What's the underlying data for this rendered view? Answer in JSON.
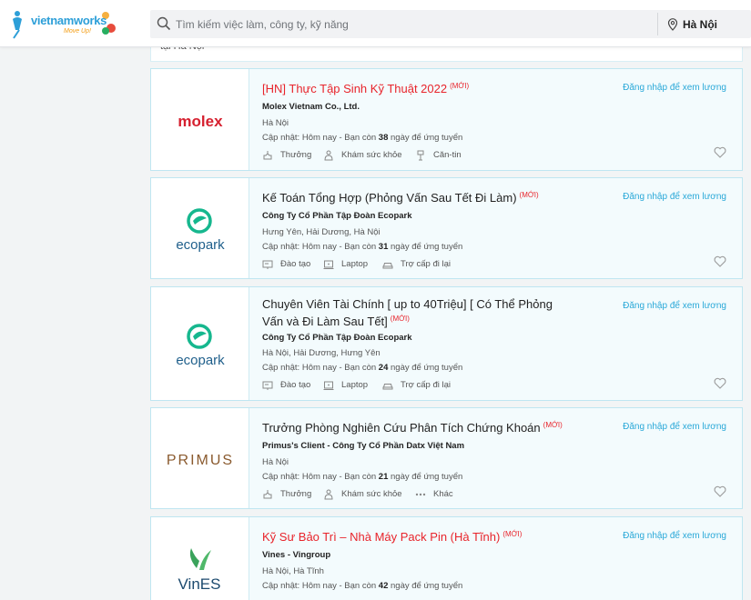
{
  "header": {
    "logo_text": "vietnamworks",
    "logo_tagline": "Move Up!",
    "search": {
      "placeholder": "Tìm kiếm việc làm, công ty, kỹ năng",
      "value": ""
    },
    "location": "Hà Nội"
  },
  "prev_card": {
    "text": "tại Hà Nội"
  },
  "jobs": [
    {
      "title": "[HN] Thực Tập Sinh Kỹ Thuật 2022",
      "badge": "(MỚI)",
      "salary": "Đăng nhập để xem lương",
      "company": "Molex Vietnam Co., Ltd.",
      "company_logo_text": "molex",
      "location": "Hà Nội",
      "update_prefix": "Cập nhật: Hôm nay - Bạn còn ",
      "days_left": "38",
      "update_suffix": " ngày để ứng tuyển",
      "benefits": [
        {
          "icon": "bonus-icon",
          "label": "Thưởng"
        },
        {
          "icon": "health-check-icon",
          "label": "Khám sức khỏe"
        },
        {
          "icon": "canteen-icon",
          "label": "Căn-tin"
        }
      ]
    },
    {
      "title": "Kế Toán Tổng Hợp (Phỏng Vấn Sau Tết Đi Làm)",
      "badge": "(MỚI)",
      "salary": "Đăng nhập để xem lương",
      "company": "Công Ty Cổ Phần Tập Đoàn Ecopark",
      "company_logo_text": "ecopark",
      "location": "Hưng Yên, Hải Dương, Hà Nội",
      "update_prefix": "Cập nhật: Hôm nay - Bạn còn ",
      "days_left": "31",
      "update_suffix": " ngày để ứng tuyển",
      "benefits": [
        {
          "icon": "training-icon",
          "label": "Đào tạo"
        },
        {
          "icon": "laptop-icon",
          "label": "Laptop"
        },
        {
          "icon": "car-icon",
          "label": "Trợ cấp đi lại"
        }
      ]
    },
    {
      "title": "Chuyên Viên Tài Chính [ up to 40Triệu] [ Có Thể Phỏng Vấn và Đi Làm Sau Tết]",
      "badge": "(MỚI)",
      "salary": "Đăng nhập để xem lương",
      "company": "Công Ty Cổ Phần Tập Đoàn Ecopark",
      "company_logo_text": "ecopark",
      "location": "Hà Nội, Hải Dương, Hưng Yên",
      "update_prefix": "Cập nhật: Hôm nay - Bạn còn ",
      "days_left": "24",
      "update_suffix": " ngày để ứng tuyển",
      "benefits": [
        {
          "icon": "training-icon",
          "label": "Đào tạo"
        },
        {
          "icon": "laptop-icon",
          "label": "Laptop"
        },
        {
          "icon": "car-icon",
          "label": "Trợ cấp đi lại"
        }
      ]
    },
    {
      "title": "Trưởng Phòng Nghiên Cứu Phân Tích Chứng Khoán",
      "badge": "(MỚI)",
      "salary": "Đăng nhập để xem lương",
      "company": "Primus's Client - Công Ty Cổ Phần Datx Việt Nam",
      "company_logo_text": "PRIMUS",
      "location": "Hà Nội",
      "update_prefix": "Cập nhật: Hôm nay - Bạn còn ",
      "days_left": "21",
      "update_suffix": " ngày để ứng tuyển",
      "benefits": [
        {
          "icon": "bonus-icon",
          "label": "Thưởng"
        },
        {
          "icon": "health-check-icon",
          "label": "Khám sức khỏe"
        },
        {
          "icon": "more-icon",
          "label": "Khác"
        }
      ]
    },
    {
      "title": "Kỹ Sư Bảo Trì – Nhà Máy Pack Pin (Hà Tĩnh)",
      "badge": "(MỚI)",
      "salary": "Đăng nhập để xem lương",
      "company": "Vines - Vingroup",
      "company_logo_text": "VinES",
      "location": "Hà Nội, Hà Tĩnh",
      "update_prefix": "Cập nhật: Hôm nay - Bạn còn ",
      "days_left": "42",
      "update_suffix": " ngày để ứng tuyển",
      "benefits": []
    }
  ],
  "colors": {
    "brand_blue": "#29a8d8",
    "new_red": "#e8242b",
    "card_bg": "#f3fbfd",
    "card_border": "#bfe6f1"
  }
}
